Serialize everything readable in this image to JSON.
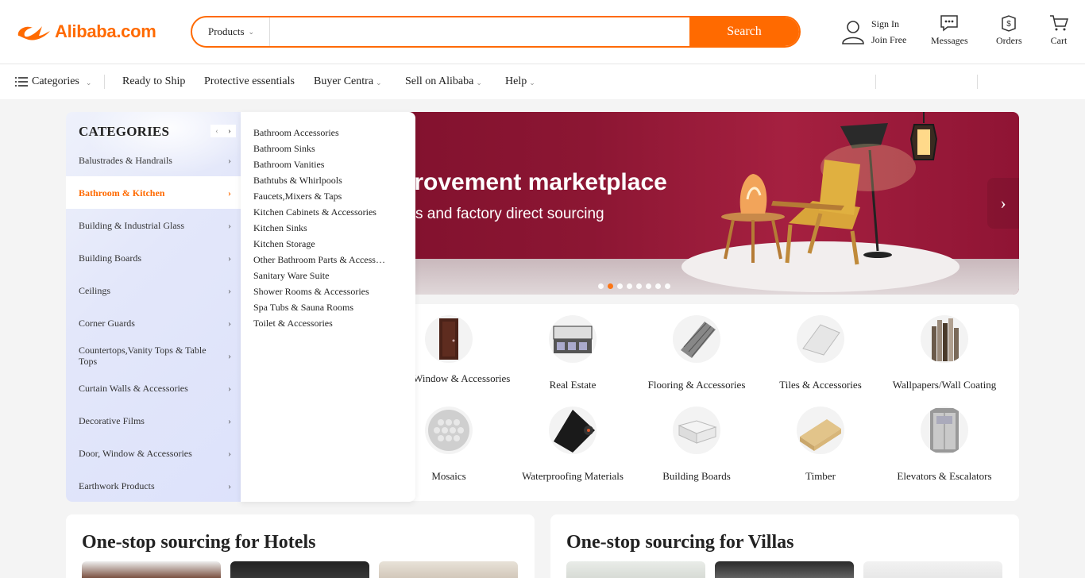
{
  "header": {
    "logo_text": "Alibaba.com",
    "search": {
      "type_label": "Products",
      "placeholder": "",
      "button_label": "Search"
    },
    "account": {
      "sign_in": "Sign In",
      "join_free": "Join Free"
    },
    "messages_label": "Messages",
    "orders_label": "Orders",
    "cart_label": "Cart"
  },
  "nav": {
    "categories_label": "Categories",
    "items": [
      "Ready to Ship",
      "Protective essentials",
      "Buyer Centra",
      "Sell on Alibaba",
      "Help"
    ]
  },
  "categories": {
    "title": "CATEGORIES",
    "items": [
      "Balustrades & Handrails",
      "Bathroom & Kitchen",
      "Building & Industrial Glass",
      "Building Boards",
      "Ceilings",
      "Corner Guards",
      "Countertops,Vanity Tops & Table Tops",
      "Curtain Walls & Accessories",
      "Decorative Films",
      "Door, Window & Accessories",
      "Earthwork Products"
    ],
    "active_index": 1
  },
  "flyout": {
    "items": [
      "Bathroom Accessories",
      "Bathroom Sinks",
      "Bathroom Vanities",
      "Bathtubs & Whirlpools",
      "Faucets,Mixers & Taps",
      "Kitchen Cabinets & Accessories",
      "Kitchen Sinks",
      "Kitchen Storage",
      "Other Bathroom Parts & Accessories",
      "Sanitary Ware Suite",
      "Shower Rooms & Accessories",
      "Spa Tubs & Sauna Rooms",
      "Toilet & Accessories"
    ]
  },
  "banner": {
    "headline": "provement marketplace",
    "subline": "s and factory direct sourcing",
    "slide_count": 8,
    "active_slide": 1
  },
  "grid": {
    "items": [
      "Door, Window & Accessories",
      "Real Estate",
      "Flooring & Accessories",
      "Tiles & Accessories",
      "Wallpapers/Wall Coating",
      "Mosaics",
      "Waterproofing Materials",
      "Building Boards",
      "Timber",
      "Elevators & Escalators"
    ]
  },
  "sections": {
    "hotels_title": "One-stop sourcing for Hotels",
    "villas_title": "One-stop sourcing for Villas"
  },
  "colors": {
    "brand": "#ff6a00",
    "banner": "#8c1633"
  }
}
